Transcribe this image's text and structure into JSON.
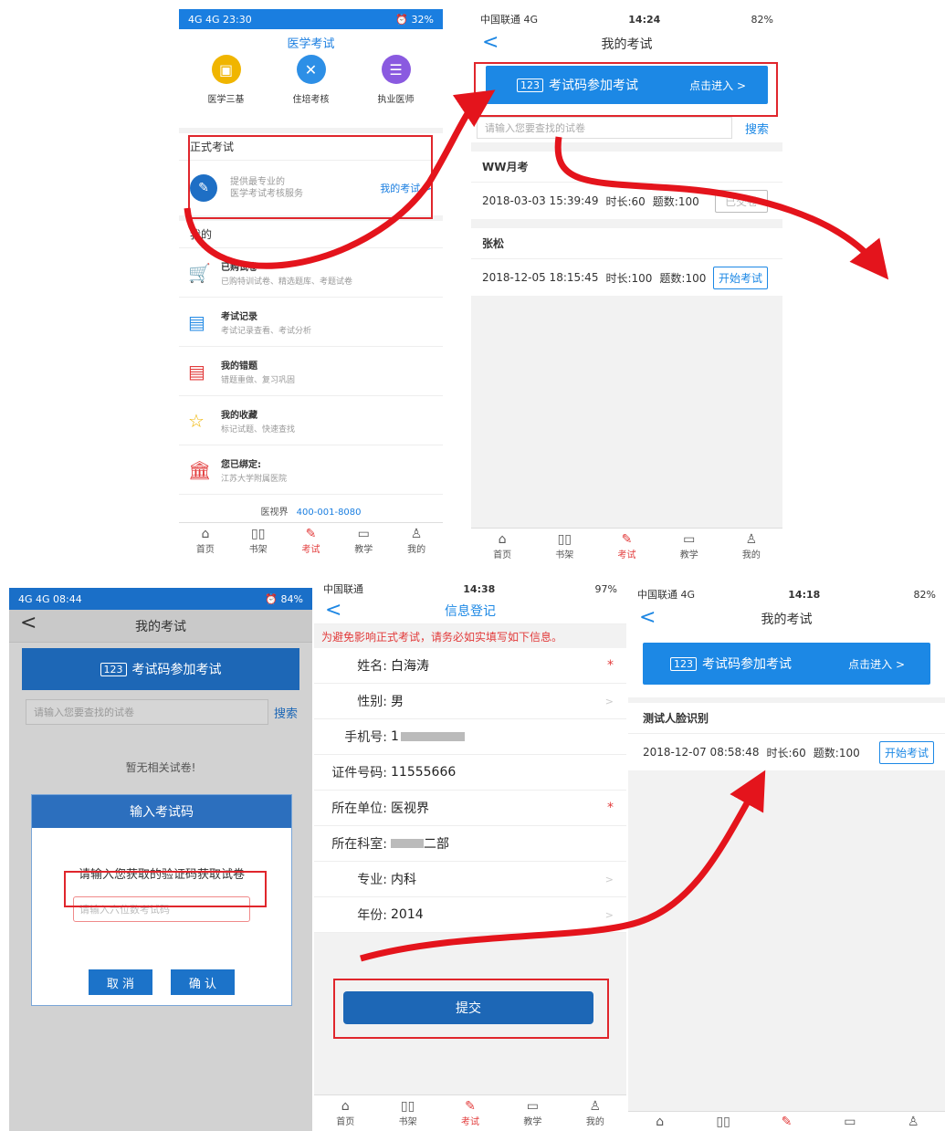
{
  "s1": {
    "status_left": "4G 4G 23:30",
    "status_right": "⏰ 32%",
    "title": "医学考试",
    "cats": [
      "医学三基",
      "住培考核",
      "执业医师"
    ],
    "formal_title": "正式考试",
    "formal_desc1": "提供最专业的",
    "formal_desc2": "医学考试考核服务",
    "my_exam_link": "我的考试 >",
    "mine_title": "我的",
    "items": [
      {
        "title": "已购试卷",
        "desc": "已购特训试卷、精选题库、考题试卷"
      },
      {
        "title": "考试记录",
        "desc": "考试记录查看、考试分析"
      },
      {
        "title": "我的错题",
        "desc": "错题重做、复习巩固"
      },
      {
        "title": "我的收藏",
        "desc": "标记试题、快速查找"
      },
      {
        "title": "您已绑定:",
        "desc": "江苏大学附属医院"
      }
    ],
    "hotline_label": "医视界",
    "hotline": "400-001-8080",
    "tabs": [
      "首页",
      "书架",
      "考试",
      "教学",
      "我的"
    ]
  },
  "s2": {
    "carrier": "中国联通 4G",
    "time": "14:24",
    "battery": "82%",
    "title": "我的考试",
    "code_btn": "考试码参加考试",
    "enter": "点击进入 >",
    "search_ph": "请输入您要查找的试卷",
    "search_btn": "搜索",
    "exams": [
      {
        "name": "WW月考",
        "date": "2018-03-03 15:39:49",
        "dur": "时长:60",
        "count": "题数:100",
        "action": "已交卷"
      },
      {
        "name": "张松",
        "date": "2018-12-05 18:15:45",
        "dur": "时长:100",
        "count": "题数:100",
        "action": "开始考试"
      }
    ],
    "tabs": [
      "首页",
      "书架",
      "考试",
      "教学",
      "我的"
    ]
  },
  "s3": {
    "status_left": "4G 4G 08:44",
    "status_right": "⏰ 84%",
    "title": "我的考试",
    "code_btn": "考试码参加考试",
    "search_ph": "请输入您要查找的试卷",
    "search_btn": "搜索",
    "empty": "暂无相关试卷!",
    "dlg_title": "输入考试码",
    "dlg_msg": "请输入您获取的验证码获取试卷",
    "dlg_ph": "请输入六位数考试码",
    "cancel": "取 消",
    "confirm": "确 认"
  },
  "s4": {
    "carrier": "中国联通",
    "time": "14:38",
    "battery": "97%",
    "title": "信息登记",
    "warn": "为避免影响正式考试，请务必如实填写如下信息。",
    "fields": [
      {
        "label": "姓名:",
        "value": "白海涛",
        "mark": "*"
      },
      {
        "label": "性别:",
        "value": "男",
        "mark": ">"
      },
      {
        "label": "手机号:",
        "value": "1",
        "mark": ""
      },
      {
        "label": "证件号码:",
        "value": "11555666",
        "mark": ""
      },
      {
        "label": "所在单位:",
        "value": "医视界",
        "mark": "*"
      },
      {
        "label": "所在科室:",
        "value": "二部",
        "mark": ""
      },
      {
        "label": "专业:",
        "value": "内科",
        "mark": ">"
      },
      {
        "label": "年份:",
        "value": "2014",
        "mark": ">"
      }
    ],
    "submit": "提交",
    "tabs": [
      "首页",
      "书架",
      "考试",
      "教学",
      "我的"
    ]
  },
  "s5": {
    "carrier": "中国联通 4G",
    "time": "14:18",
    "battery": "82%",
    "title": "我的考试",
    "code_btn": "考试码参加考试",
    "enter": "点击进入 >",
    "exam": {
      "name": "测试人脸识别",
      "date": "2018-12-07 08:58:48",
      "dur": "时长:60",
      "count": "题数:100",
      "action": "开始考试"
    }
  }
}
